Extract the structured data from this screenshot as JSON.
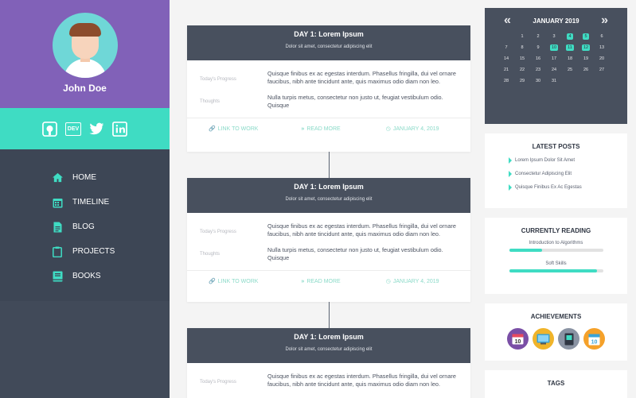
{
  "profile": {
    "name": "John Doe"
  },
  "socials": [
    {
      "name": "github-icon"
    },
    {
      "name": "dev-icon",
      "label": "DEV"
    },
    {
      "name": "twitter-icon"
    },
    {
      "name": "linkedin-icon"
    }
  ],
  "nav": {
    "items": [
      {
        "label": "HOME",
        "icon": "home-icon"
      },
      {
        "label": "TIMELINE",
        "icon": "calendar-icon"
      },
      {
        "label": "BLOG",
        "icon": "document-icon"
      },
      {
        "label": "PROJECTS",
        "icon": "clipboard-icon"
      },
      {
        "label": "BOOKS",
        "icon": "book-icon"
      }
    ]
  },
  "posts": [
    {
      "title": "DAY 1:  Lorem Ipsum",
      "subtitle": "Dolor sit amet, consectetur adipiscing elit",
      "progress_label": "Today's Progress",
      "progress_text": "Quisque finibus ex ac egestas interdum. Phasellus fringilla, dui vel ornare faucibus, nibh ante tincidunt ante, quis maximus odio diam non leo.",
      "thoughts_label": "Thoughts",
      "thoughts_text": "Nulla turpis metus, consectetur non justo ut, feugiat vestibulum odio. Quisque",
      "link_label": "LINK TO WORK",
      "read_label": "READ MORE",
      "date": "JANUARY 4, 2019"
    },
    {
      "title": "DAY 1:  Lorem Ipsum",
      "subtitle": "Dolor sit amet, consectetur adipiscing elit",
      "progress_label": "Today's Progress",
      "progress_text": "Quisque finibus ex ac egestas interdum. Phasellus fringilla, dui vel ornare faucibus, nibh ante tincidunt ante, quis maximus odio diam non leo.",
      "thoughts_label": "Thoughts",
      "thoughts_text": "Nulla turpis metus, consectetur non justo ut, feugiat vestibulum odio. Quisque",
      "link_label": "LINK TO WORK",
      "read_label": "READ MORE",
      "date": "JANUARY 4, 2019"
    },
    {
      "title": "DAY 1:  Lorem Ipsum",
      "subtitle": "Dolor sit amet, consectetur adipiscing elit",
      "progress_label": "Today's Progress",
      "progress_text": "Quisque finibus ex ac egestas interdum. Phasellus fringilla, dui vel ornare faucibus, nibh ante tincidunt ante, quis maximus odio diam non leo."
    }
  ],
  "calendar": {
    "month": "JANUARY 2019",
    "prev": "«",
    "next": "»",
    "weeks": [
      [
        "",
        "1",
        "2",
        "3",
        "4",
        "5",
        "6"
      ],
      [
        "7",
        "8",
        "9",
        "10",
        "11",
        "12",
        "13"
      ],
      [
        "14",
        "15",
        "16",
        "17",
        "18",
        "19",
        "20"
      ],
      [
        "21",
        "22",
        "23",
        "24",
        "25",
        "26",
        "27"
      ],
      [
        "28",
        "29",
        "30",
        "31",
        "",
        "",
        ""
      ]
    ],
    "highlighted": [
      "4",
      "5",
      "10",
      "11",
      "12"
    ]
  },
  "latest_posts": {
    "title": "LATEST POSTS",
    "items": [
      "Lorem Ipsum Dolor Sit Amet",
      "Consectetur Adipiscing Elit",
      "Quisque Finibus Ex Ac Egestas"
    ]
  },
  "reading": {
    "title": "CURRENTLY READING",
    "books": [
      {
        "title": "Introduction to Algorithms",
        "progress": 0.35
      },
      {
        "title": "Soft Skills",
        "progress": 0.94
      }
    ]
  },
  "achievements": {
    "title": "ACHIEVEMENTS",
    "badges": [
      {
        "icon": "calendar-badge-icon",
        "color": "#7a4fa6",
        "label": "10"
      },
      {
        "icon": "screen-badge-icon",
        "color": "#f0b42a"
      },
      {
        "icon": "book-badge-icon",
        "color": "#8a93a3"
      },
      {
        "icon": "calendar-10-badge-icon",
        "color": "#f5a12a",
        "label": "10"
      }
    ]
  },
  "tags": {
    "title": "TAGS"
  },
  "colors": {
    "accent": "#3fdcc3",
    "purple": "#8161b8",
    "dark": "#48505e",
    "sidebar": "#414a59"
  }
}
